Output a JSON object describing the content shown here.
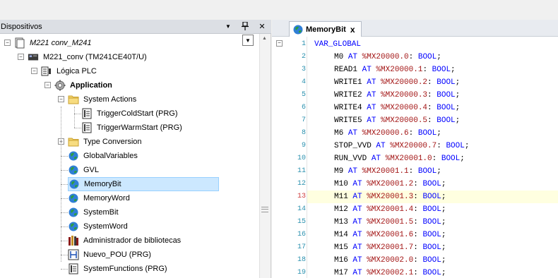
{
  "left_panel": {
    "title": "Dispositivos",
    "pin_glyph": "ꟸ",
    "close_glyph": "✕",
    "menu_glyph": "▼"
  },
  "tree": [
    {
      "id": "root",
      "label": "M221 conv_M241",
      "italic": true,
      "icon": "project-icon",
      "expander": "−",
      "level": 0
    },
    {
      "id": "device",
      "label": "M221_conv (TM241CE40T/U)",
      "icon": "plc-device-icon",
      "expander": "−",
      "level": 1
    },
    {
      "id": "logic",
      "label": "Lógica PLC",
      "icon": "plc-logic-icon",
      "expander": "−",
      "level": 2
    },
    {
      "id": "application",
      "label": "Application",
      "bold": true,
      "icon": "gear-icon",
      "expander": "−",
      "level": 3
    },
    {
      "id": "sysactions",
      "label": "System Actions",
      "icon": "folder-icon",
      "expander": "−",
      "level": 4
    },
    {
      "id": "coldstart",
      "label": "TriggerColdStart (PRG)",
      "icon": "program-icon",
      "level": 5
    },
    {
      "id": "warmstart",
      "label": "TriggerWarmStart (PRG)",
      "icon": "program-icon",
      "level": 5
    },
    {
      "id": "typeconv",
      "label": "Type Conversion",
      "icon": "folder-icon",
      "expander": "+",
      "level": 4
    },
    {
      "id": "globalvars",
      "label": "GlobalVariables",
      "icon": "globe-icon",
      "level": 4
    },
    {
      "id": "gvl",
      "label": "GVL",
      "icon": "globe-icon",
      "level": 4
    },
    {
      "id": "memorybit",
      "label": "MemoryBit",
      "icon": "globe-icon",
      "level": 4,
      "selected": true
    },
    {
      "id": "memoryword",
      "label": "MemoryWord",
      "icon": "globe-icon",
      "level": 4
    },
    {
      "id": "systembit",
      "label": "SystemBit",
      "icon": "globe-icon",
      "level": 4
    },
    {
      "id": "systemword",
      "label": "SystemWord",
      "icon": "globe-icon",
      "level": 4
    },
    {
      "id": "libmgr",
      "label": "Administrador de bibliotecas",
      "icon": "library-icon",
      "level": 4
    },
    {
      "id": "nuevopou",
      "label": "Nuevo_POU (PRG)",
      "icon": "ladder-icon",
      "level": 4
    },
    {
      "id": "sysfuncs",
      "label": "SystemFunctions (PRG)",
      "icon": "program-icon",
      "level": 4
    }
  ],
  "editor": {
    "tab_label": "MemoryBit",
    "tab_close": "x",
    "highlight_line": 13,
    "lines": [
      {
        "n": "1",
        "parts": [
          {
            "t": "VAR_GLOBAL",
            "c": "kw"
          }
        ],
        "indent": 0
      },
      {
        "n": "2",
        "parts": [
          {
            "t": "M0 ",
            "c": ""
          },
          {
            "t": "AT",
            "c": "kw"
          },
          {
            "t": " %MX20000.0",
            "c": "addr"
          },
          {
            "t": ": ",
            "c": ""
          },
          {
            "t": "BOOL",
            "c": "kw"
          },
          {
            "t": ";",
            "c": ""
          }
        ],
        "indent": 1
      },
      {
        "n": "3",
        "parts": [
          {
            "t": "READ1 ",
            "c": ""
          },
          {
            "t": "AT",
            "c": "kw"
          },
          {
            "t": " %MX20000.1",
            "c": "addr"
          },
          {
            "t": ": ",
            "c": ""
          },
          {
            "t": "BOOL",
            "c": "kw"
          },
          {
            "t": ";",
            "c": ""
          }
        ],
        "indent": 1
      },
      {
        "n": "4",
        "parts": [
          {
            "t": "WRITE1 ",
            "c": ""
          },
          {
            "t": "AT",
            "c": "kw"
          },
          {
            "t": " %MX20000.2",
            "c": "addr"
          },
          {
            "t": ": ",
            "c": ""
          },
          {
            "t": "BOOL",
            "c": "kw"
          },
          {
            "t": ";",
            "c": ""
          }
        ],
        "indent": 1
      },
      {
        "n": "5",
        "parts": [
          {
            "t": "WRITE2 ",
            "c": ""
          },
          {
            "t": "AT",
            "c": "kw"
          },
          {
            "t": " %MX20000.3",
            "c": "addr"
          },
          {
            "t": ": ",
            "c": ""
          },
          {
            "t": "BOOL",
            "c": "kw"
          },
          {
            "t": ";",
            "c": ""
          }
        ],
        "indent": 1
      },
      {
        "n": "6",
        "parts": [
          {
            "t": "WRITE4 ",
            "c": ""
          },
          {
            "t": "AT",
            "c": "kw"
          },
          {
            "t": " %MX20000.4",
            "c": "addr"
          },
          {
            "t": ": ",
            "c": ""
          },
          {
            "t": "BOOL",
            "c": "kw"
          },
          {
            "t": ";",
            "c": ""
          }
        ],
        "indent": 1
      },
      {
        "n": "7",
        "parts": [
          {
            "t": "WRITE5 ",
            "c": ""
          },
          {
            "t": "AT",
            "c": "kw"
          },
          {
            "t": " %MX20000.5",
            "c": "addr"
          },
          {
            "t": ": ",
            "c": ""
          },
          {
            "t": "BOOL",
            "c": "kw"
          },
          {
            "t": ";",
            "c": ""
          }
        ],
        "indent": 1
      },
      {
        "n": "8",
        "parts": [
          {
            "t": "M6 ",
            "c": ""
          },
          {
            "t": "AT",
            "c": "kw"
          },
          {
            "t": " %MX20000.6",
            "c": "addr"
          },
          {
            "t": ": ",
            "c": ""
          },
          {
            "t": "BOOL",
            "c": "kw"
          },
          {
            "t": ";",
            "c": ""
          }
        ],
        "indent": 1
      },
      {
        "n": "9",
        "parts": [
          {
            "t": "STOP_VVD ",
            "c": ""
          },
          {
            "t": "AT",
            "c": "kw"
          },
          {
            "t": " %MX20000.7",
            "c": "addr"
          },
          {
            "t": ": ",
            "c": ""
          },
          {
            "t": "BOOL",
            "c": "kw"
          },
          {
            "t": ";",
            "c": ""
          }
        ],
        "indent": 1
      },
      {
        "n": "10",
        "parts": [
          {
            "t": "RUN_VVD ",
            "c": ""
          },
          {
            "t": "AT",
            "c": "kw"
          },
          {
            "t": " %MX20001.0",
            "c": "addr"
          },
          {
            "t": ": ",
            "c": ""
          },
          {
            "t": "BOOL",
            "c": "kw"
          },
          {
            "t": ";",
            "c": ""
          }
        ],
        "indent": 1
      },
      {
        "n": "11",
        "parts": [
          {
            "t": "M9 ",
            "c": ""
          },
          {
            "t": "AT",
            "c": "kw"
          },
          {
            "t": " %MX20001.1",
            "c": "addr"
          },
          {
            "t": ": ",
            "c": ""
          },
          {
            "t": "BOOL",
            "c": "kw"
          },
          {
            "t": ";",
            "c": ""
          }
        ],
        "indent": 1
      },
      {
        "n": "12",
        "parts": [
          {
            "t": "M10 ",
            "c": ""
          },
          {
            "t": "AT",
            "c": "kw"
          },
          {
            "t": " %MX20001.2",
            "c": "addr"
          },
          {
            "t": ": ",
            "c": ""
          },
          {
            "t": "BOOL",
            "c": "kw"
          },
          {
            "t": ";",
            "c": ""
          }
        ],
        "indent": 1
      },
      {
        "n": "13",
        "parts": [
          {
            "t": "M11 ",
            "c": ""
          },
          {
            "t": "AT",
            "c": "kw"
          },
          {
            "t": " %MX20001.3",
            "c": "addr"
          },
          {
            "t": ": ",
            "c": ""
          },
          {
            "t": "BOOL",
            "c": "kw"
          },
          {
            "t": ";",
            "c": ""
          }
        ],
        "indent": 1
      },
      {
        "n": "14",
        "parts": [
          {
            "t": "M12 ",
            "c": ""
          },
          {
            "t": "AT",
            "c": "kw"
          },
          {
            "t": " %MX20001.4",
            "c": "addr"
          },
          {
            "t": ": ",
            "c": ""
          },
          {
            "t": "BOOL",
            "c": "kw"
          },
          {
            "t": ";",
            "c": ""
          }
        ],
        "indent": 1
      },
      {
        "n": "15",
        "parts": [
          {
            "t": "M13 ",
            "c": ""
          },
          {
            "t": "AT",
            "c": "kw"
          },
          {
            "t": " %MX20001.5",
            "c": "addr"
          },
          {
            "t": ": ",
            "c": ""
          },
          {
            "t": "BOOL",
            "c": "kw"
          },
          {
            "t": ";",
            "c": ""
          }
        ],
        "indent": 1
      },
      {
        "n": "16",
        "parts": [
          {
            "t": "M14 ",
            "c": ""
          },
          {
            "t": "AT",
            "c": "kw"
          },
          {
            "t": " %MX20001.6",
            "c": "addr"
          },
          {
            "t": ": ",
            "c": ""
          },
          {
            "t": "BOOL",
            "c": "kw"
          },
          {
            "t": ";",
            "c": ""
          }
        ],
        "indent": 1
      },
      {
        "n": "17",
        "parts": [
          {
            "t": "M15 ",
            "c": ""
          },
          {
            "t": "AT",
            "c": "kw"
          },
          {
            "t": " %MX20001.7",
            "c": "addr"
          },
          {
            "t": ": ",
            "c": ""
          },
          {
            "t": "BOOL",
            "c": "kw"
          },
          {
            "t": ";",
            "c": ""
          }
        ],
        "indent": 1
      },
      {
        "n": "18",
        "parts": [
          {
            "t": "M16 ",
            "c": ""
          },
          {
            "t": "AT",
            "c": "kw"
          },
          {
            "t": " %MX20002.0",
            "c": "addr"
          },
          {
            "t": ": ",
            "c": ""
          },
          {
            "t": "BOOL",
            "c": "kw"
          },
          {
            "t": ";",
            "c": ""
          }
        ],
        "indent": 1
      },
      {
        "n": "19",
        "parts": [
          {
            "t": "M17 ",
            "c": ""
          },
          {
            "t": "AT",
            "c": "kw"
          },
          {
            "t": " %MX20002.1",
            "c": "addr"
          },
          {
            "t": ": ",
            "c": ""
          },
          {
            "t": "BOOL",
            "c": "kw"
          },
          {
            "t": ";",
            "c": ""
          }
        ],
        "indent": 1
      }
    ]
  },
  "colors": {
    "keyword": "#0000ff",
    "address": "#a31515",
    "line_number": "#2b91af",
    "selection": "#cce8ff",
    "highlight_line": "#ffffe0"
  }
}
